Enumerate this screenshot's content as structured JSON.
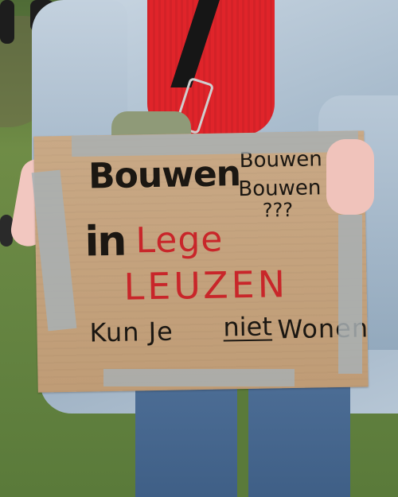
{
  "sign": {
    "line1": "Bouwen",
    "line2": "Bouwen",
    "line3": "Bouwen",
    "line4": "???",
    "line5a": "in",
    "line5b": "Lege",
    "line6": "LEUZEN",
    "line7a": "Kun Je",
    "line7b": "niet",
    "line7c": "Wonen"
  },
  "colors": {
    "cardboard": "#c6a47e",
    "black_marker": "#1b1712",
    "red_marker": "#c8262a",
    "jacket": "#a9bccd",
    "shirt": "#e0242a",
    "grass": "#668542"
  }
}
